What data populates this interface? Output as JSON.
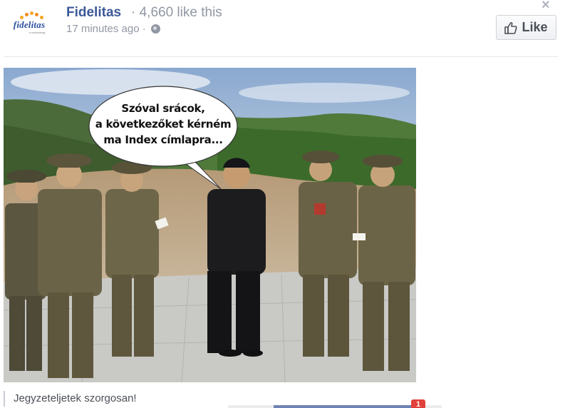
{
  "post": {
    "page_name": "Fidelitas",
    "likes_text": "· 4,660 like this",
    "timestamp": "17 minutes ago ·",
    "like_button_label": "Like",
    "close_symbol": "×",
    "avatar_logo_text": "fidelitas",
    "avatar_logo_sub": "a szabadság",
    "caption": "Jegyzeteljetek szorgosan!",
    "notification_count": "1"
  },
  "photo": {
    "speech_bubble_lines": [
      "Szóval srácok,",
      "a következőket kérném",
      "ma Index címlapra..."
    ]
  },
  "icons": {
    "globe": "globe-icon",
    "thumbs_up": "thumbs-up-icon",
    "close": "close-icon"
  },
  "colors": {
    "brand_blue": "#3b5998",
    "muted_text": "#9197a3",
    "notification_red": "#e0413b"
  }
}
